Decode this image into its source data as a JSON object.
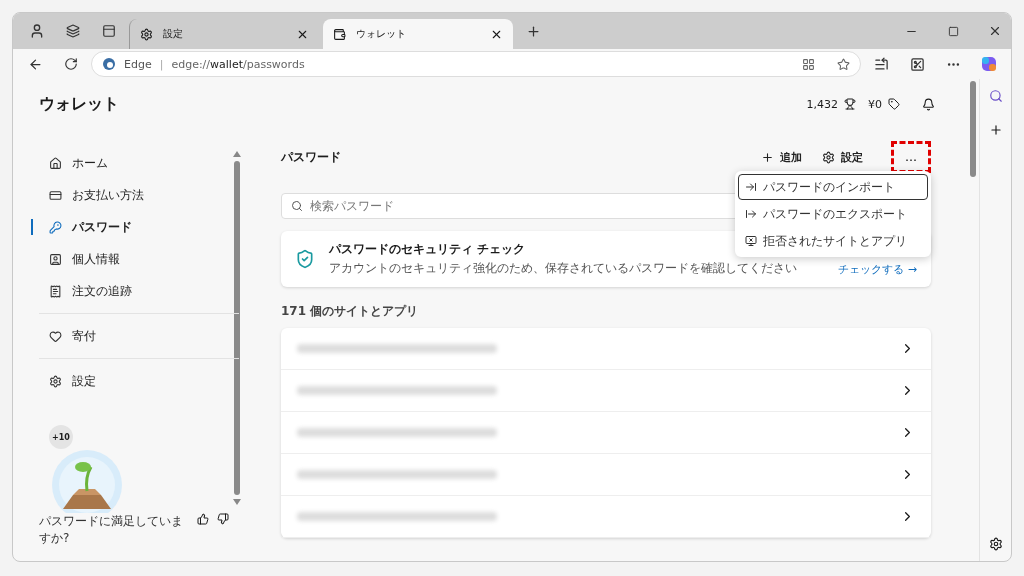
{
  "tabs": [
    {
      "title": "設定",
      "selected": false
    },
    {
      "title": "ウォレット",
      "selected": true
    }
  ],
  "address": {
    "site": "Edge",
    "separator": "|",
    "url_prefix": "edge://",
    "url_host": "wallet",
    "url_path": "/passwords"
  },
  "page": {
    "title": "ウォレット",
    "points": "1,432",
    "cashback": "¥0"
  },
  "sidebar": {
    "items": [
      {
        "label": "ホーム",
        "selected": false
      },
      {
        "label": "お支払い方法",
        "selected": false
      },
      {
        "label": "パスワード",
        "selected": true
      },
      {
        "label": "個人情報",
        "selected": false
      },
      {
        "label": "注文の追跡",
        "selected": false
      },
      {
        "label": "寄付",
        "selected": false
      },
      {
        "label": "設定",
        "selected": false
      }
    ],
    "badge": "+10",
    "feedback": "パスワードに満足していますか?"
  },
  "main": {
    "title": "パスワード",
    "add": "追加",
    "settings": "設定",
    "more": "…",
    "search": {
      "placeholder": "検索パスワード"
    },
    "security": {
      "title": "パスワードのセキュリティ チェック",
      "text": "アカウントのセキュリティ強化のため、保存されているパスワードを確認してください",
      "link": "チェックする →"
    },
    "count": "171 個のサイトとアプリ",
    "menu": [
      {
        "label": "パスワードのインポート",
        "selected": true
      },
      {
        "label": "パスワードのエクスポート",
        "selected": false
      },
      {
        "label": "拒否されたサイトとアプリ",
        "selected": false
      }
    ]
  }
}
